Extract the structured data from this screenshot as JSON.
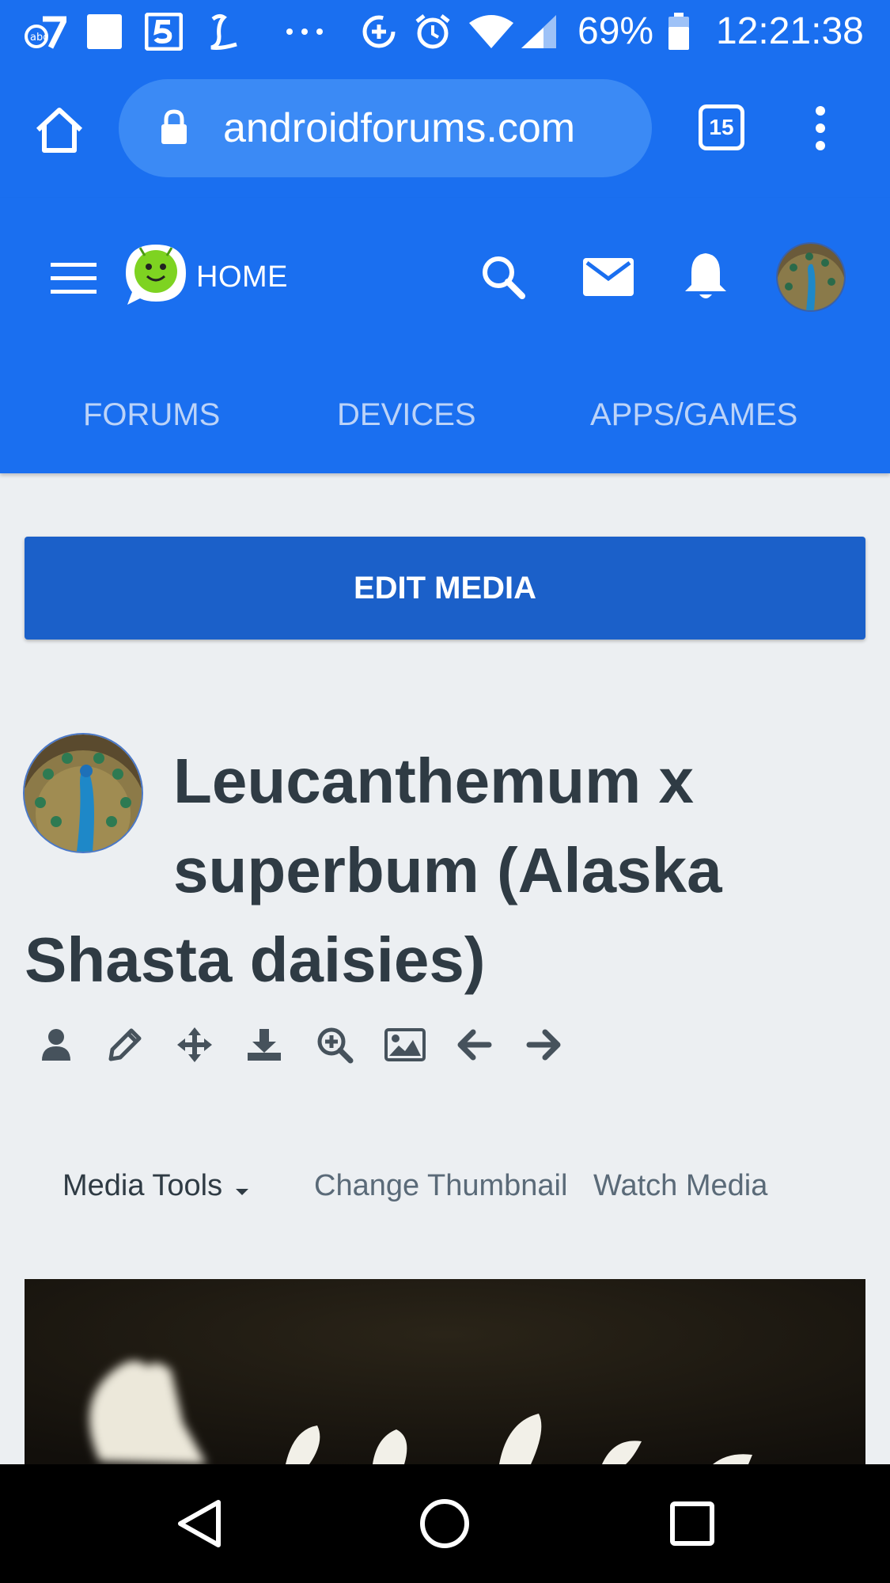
{
  "status_bar": {
    "battery": "69%",
    "time": "12:21:38",
    "icons": [
      "abc7-icon",
      "square-icon",
      "channel5-icon",
      "news-l-icon",
      "more-dots-icon",
      "data-saver-icon",
      "alarm-icon",
      "wifi-icon",
      "signal-icon",
      "battery-icon"
    ]
  },
  "browser": {
    "url": "androidforums.com",
    "tab_count": "15"
  },
  "site_header": {
    "home_label": "HOME",
    "tabs": [
      "FORUMS",
      "DEVICES",
      "APPS/GAMES"
    ]
  },
  "edit_media_label": "EDIT MEDIA",
  "page_title": "Leucanthemum x superbum (Alaska Shasta daisies)",
  "tool_icons": [
    "user-icon",
    "pencil-icon",
    "move-icon",
    "download-icon",
    "zoom-in-icon",
    "image-icon",
    "arrow-left-icon",
    "arrow-right-icon"
  ],
  "media_toolbar": {
    "media_tools": "Media Tools",
    "change_thumbnail": "Change Thumbnail",
    "watch_media": "Watch Media"
  },
  "colors": {
    "brand_blue": "#1a6ff0",
    "button_blue": "#1b60c9",
    "title_text": "#2f3b44",
    "background": "#eceff2"
  }
}
